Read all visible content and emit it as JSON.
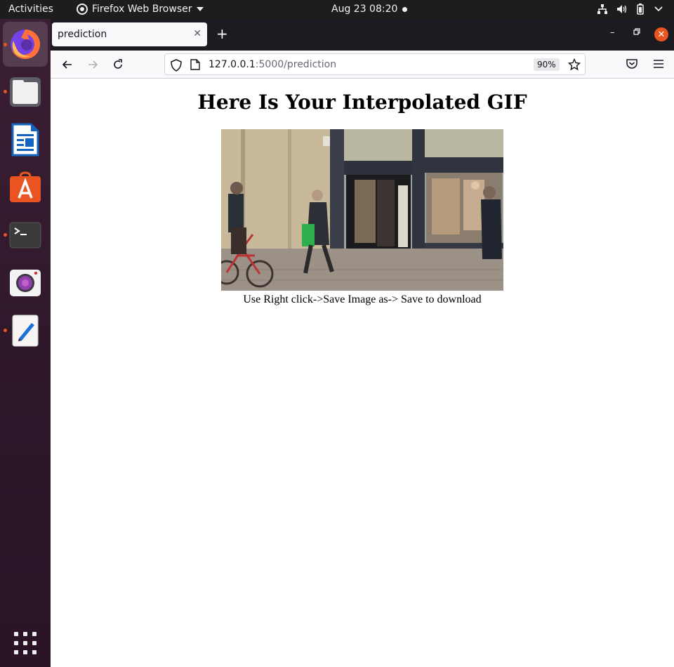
{
  "topbar": {
    "activities": "Activities",
    "app_menu": "Firefox Web Browser",
    "clock": "Aug 23  08:20",
    "tray_icons": [
      "network-icon",
      "volume-icon",
      "battery-icon",
      "power-menu-icon"
    ]
  },
  "dock": {
    "items": [
      "firefox",
      "files",
      "libreoffice-writer",
      "ubuntu-software",
      "terminal",
      "screenshot",
      "text-editor"
    ],
    "running": [
      "firefox",
      "files",
      "terminal",
      "text-editor"
    ],
    "show_apps": "show-applications-icon"
  },
  "browser": {
    "tab_title": "prediction",
    "url_host": "127.0.0.1",
    "url_rest": ":5000/prediction",
    "zoom": "90%",
    "accent_close": "#e95420"
  },
  "page": {
    "heading": "Here Is Your Interpolated GIF",
    "caption": "Use Right click->Save Image as-> Save to download"
  }
}
